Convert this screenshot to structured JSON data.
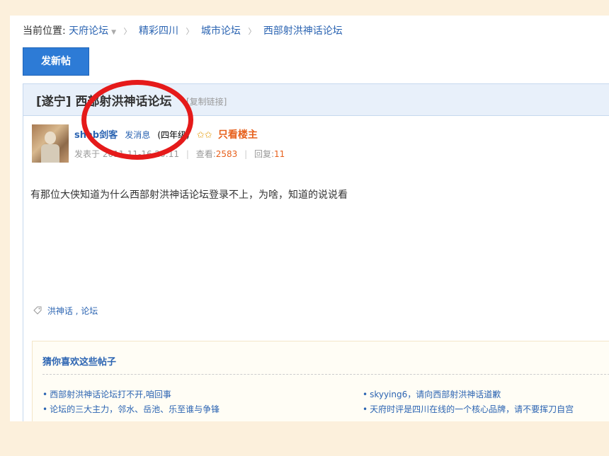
{
  "breadcrumb": {
    "prefix": "当前位置:",
    "items": [
      "天府论坛",
      "精彩四川",
      "城市论坛",
      "西部射洪神话论坛"
    ]
  },
  "toolbar": {
    "new_post_label": "发新帖"
  },
  "thread": {
    "title": "[遂宁] 西部射洪神话论坛",
    "copy_link": "[复制链接]",
    "author": "shab剑客",
    "send_message": "发消息",
    "level": "(四年级)",
    "only_op": "只看楼主",
    "posted_prefix": "发表于",
    "posted_date": "2011-11-16 20:11",
    "views_label": "查看:",
    "views": "2583",
    "replies_label": "回复:",
    "replies": "11",
    "content": "有那位大侠知道为什么西部射洪神话论坛登录不上，为啥，知道的说说看",
    "tags": "洪神话 , 论坛"
  },
  "suggestions": {
    "title": "猜你喜欢这些帖子",
    "items": [
      "西部射洪神话论坛打不开,咱回事",
      "skyying6，请向西部射洪神话道歉",
      "论坛的三大主力，邻水、岳池、乐至谁与争锋",
      "天府时评是四川在线的一个核心品牌，请不要挥刀自宫"
    ]
  },
  "colors": {
    "accent": "#2d7bd6",
    "link": "#2b64b2",
    "highlight": "#e7601c",
    "annotation": "#e51a1a"
  }
}
